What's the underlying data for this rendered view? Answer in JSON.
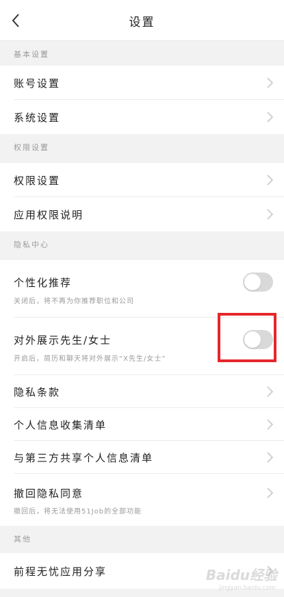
{
  "header": {
    "title": "设置"
  },
  "sections": {
    "basic": {
      "title": "基本设置"
    },
    "permission": {
      "title": "权限设置"
    },
    "privacy": {
      "title": "隐私中心"
    },
    "other": {
      "title": "其他"
    }
  },
  "rows": {
    "account": {
      "label": "账号设置"
    },
    "system": {
      "label": "系统设置"
    },
    "permission_settings": {
      "label": "权限设置"
    },
    "app_permission_desc": {
      "label": "应用权限说明"
    },
    "personalized": {
      "label": "个性化推荐",
      "sub": "关闭后，将不再为你推荐职位和公司",
      "enabled": false
    },
    "show_title": {
      "label": "对外展示先生/女士",
      "sub": "开启后，简历和聊天将对外展示“X先生/女士”",
      "enabled": false
    },
    "privacy_terms": {
      "label": "隐私条款"
    },
    "personal_info_list": {
      "label": "个人信息收集清单"
    },
    "third_party_list": {
      "label": "与第三方共享个人信息清单"
    },
    "revoke_consent": {
      "label": "撤回隐私同意",
      "sub": "撤回后，将无法使用51Job的全部功能"
    },
    "share_app": {
      "label": "前程无忧应用分享"
    }
  },
  "watermark": {
    "logo": "Baidu经验",
    "url": "jingyan.baidu.com"
  },
  "colors": {
    "highlight": "#e5262b",
    "toggle_off": "#d9d9d9"
  }
}
